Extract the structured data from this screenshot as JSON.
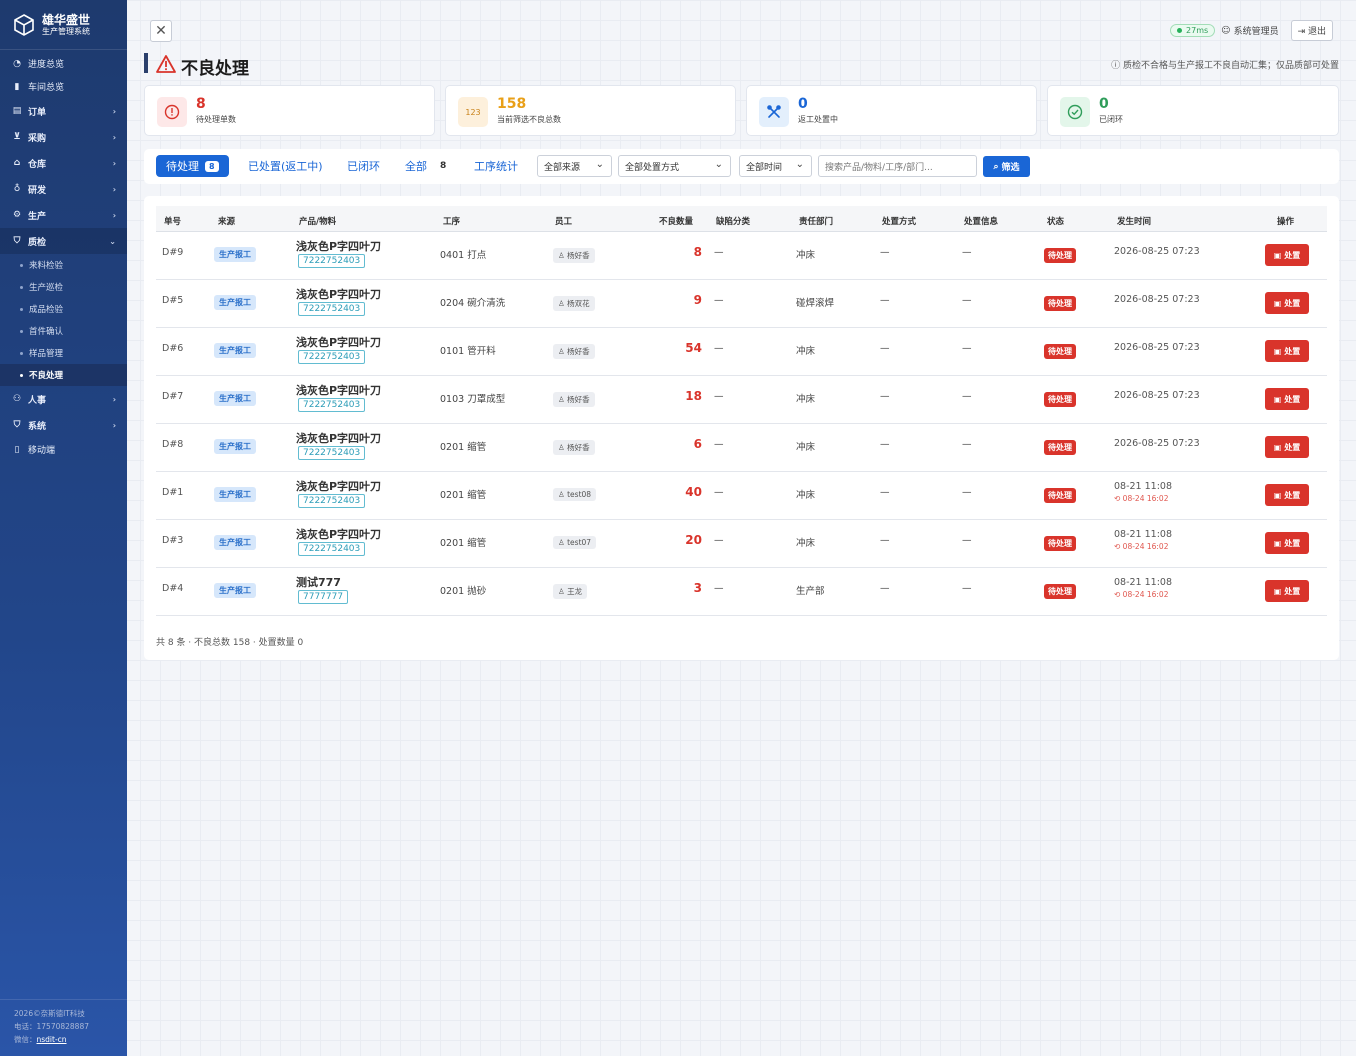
{
  "brand": {
    "title": "雄华盛世",
    "subtitle": "生产管理系统"
  },
  "sidebar": {
    "top": [
      {
        "label": "进度总览",
        "icon": "dashboard-icon"
      },
      {
        "label": "车间总览",
        "icon": "doc-icon"
      }
    ],
    "groups": [
      {
        "label": "订单",
        "icon": "order-icon"
      },
      {
        "label": "采购",
        "icon": "cart-icon"
      },
      {
        "label": "仓库",
        "icon": "home-icon"
      },
      {
        "label": "研发",
        "icon": "bulb-icon"
      },
      {
        "label": "生产",
        "icon": "gear-icon"
      }
    ],
    "open_group": {
      "label": "质检",
      "icon": "shield-icon",
      "items": [
        "来料检验",
        "生产巡检",
        "成品检验",
        "首件确认",
        "样品管理",
        "不良处理"
      ]
    },
    "bottom": [
      {
        "label": "人事",
        "icon": "people-icon"
      },
      {
        "label": "系统",
        "icon": "shield-icon"
      }
    ],
    "mobile": "移动端",
    "footer": {
      "copyright": "2026©奈斯德IT科技",
      "phone": "电话：17570828887",
      "wechat_label": "微信：",
      "wechat": "nsdit-cn"
    }
  },
  "header": {
    "latency": "27ms",
    "user": "系统管理员",
    "logout": "退出"
  },
  "page": {
    "title": "不良处理",
    "hint": "质检不合格与生产报工不良自动汇集；仅品质部可处置"
  },
  "stats": [
    {
      "value": "8",
      "label": "待处理单数",
      "color": "#d9342b",
      "bg": "#fde8e8",
      "icon": "alert-icon"
    },
    {
      "value": "158",
      "label": "当前筛选不良总数",
      "color": "#e9a018",
      "bg": "#fdf0dc",
      "icon": "123",
      "icon_name": "number-icon"
    },
    {
      "value": "0",
      "label": "返工处置中",
      "color": "#1a66d6",
      "bg": "#e3effc",
      "icon": "tools-icon"
    },
    {
      "value": "0",
      "label": "已闭环",
      "color": "#2f9d5a",
      "bg": "#e3f6ea",
      "icon": "check-icon"
    }
  ],
  "tabs": {
    "pending": "待处理",
    "pending_count": "8",
    "reworking": "已处置(返工中)",
    "closed": "已闭环",
    "all": "全部",
    "all_count": "8",
    "stats": "工序统计"
  },
  "filters": {
    "source": "全部来源",
    "method": "全部处置方式",
    "time": "全部时间",
    "search_placeholder": "搜索产品/物料/工序/部门...",
    "search_btn": "筛选"
  },
  "table": {
    "headers": [
      "单号",
      "来源",
      "产品/物料",
      "工序",
      "员工",
      "不良数量",
      "缺陷分类",
      "责任部门",
      "处置方式",
      "处置信息",
      "状态",
      "发生时间",
      "操作"
    ],
    "rows": [
      {
        "id": "D#9",
        "source": "生产报工",
        "product": "浅灰色P字四叶刀",
        "code": "7222752403",
        "process": "0401 打点",
        "employee": "杨好香",
        "qty": "8",
        "defect": "—",
        "dept": "冲床",
        "method": "—",
        "info": "—",
        "status": "待处理",
        "time": "2026-08-25 07:23",
        "time_sub": "",
        "action": "处置"
      },
      {
        "id": "D#5",
        "source": "生产报工",
        "product": "浅灰色P字四叶刀",
        "code": "7222752403",
        "process": "0204 碗介清洗",
        "employee": "杨双花",
        "qty": "9",
        "defect": "—",
        "dept": "碰焊滚焊",
        "method": "—",
        "info": "—",
        "status": "待处理",
        "time": "2026-08-25 07:23",
        "time_sub": "",
        "action": "处置"
      },
      {
        "id": "D#6",
        "source": "生产报工",
        "product": "浅灰色P字四叶刀",
        "code": "7222752403",
        "process": "0101 管开料",
        "employee": "杨好香",
        "qty": "54",
        "defect": "—",
        "dept": "冲床",
        "method": "—",
        "info": "—",
        "status": "待处理",
        "time": "2026-08-25 07:23",
        "time_sub": "",
        "action": "处置"
      },
      {
        "id": "D#7",
        "source": "生产报工",
        "product": "浅灰色P字四叶刀",
        "code": "7222752403",
        "process": "0103 刀罩成型",
        "employee": "杨好香",
        "qty": "18",
        "defect": "—",
        "dept": "冲床",
        "method": "—",
        "info": "—",
        "status": "待处理",
        "time": "2026-08-25 07:23",
        "time_sub": "",
        "action": "处置"
      },
      {
        "id": "D#8",
        "source": "生产报工",
        "product": "浅灰色P字四叶刀",
        "code": "7222752403",
        "process": "0201 缩管",
        "employee": "杨好香",
        "qty": "6",
        "defect": "—",
        "dept": "冲床",
        "method": "—",
        "info": "—",
        "status": "待处理",
        "time": "2026-08-25 07:23",
        "time_sub": "",
        "action": "处置"
      },
      {
        "id": "D#1",
        "source": "生产报工",
        "product": "浅灰色P字四叶刀",
        "code": "7222752403",
        "process": "0201 缩管",
        "employee": "test08",
        "qty": "40",
        "defect": "—",
        "dept": "冲床",
        "method": "—",
        "info": "—",
        "status": "待处理",
        "time": "08-21 11:08",
        "time_sub": "08-24 16:02",
        "action": "处置"
      },
      {
        "id": "D#3",
        "source": "生产报工",
        "product": "浅灰色P字四叶刀",
        "code": "7222752403",
        "process": "0201 缩管",
        "employee": "test07",
        "qty": "20",
        "defect": "—",
        "dept": "冲床",
        "method": "—",
        "info": "—",
        "status": "待处理",
        "time": "08-21 11:08",
        "time_sub": "08-24 16:02",
        "action": "处置"
      },
      {
        "id": "D#4",
        "source": "生产报工",
        "product": "测试777",
        "code": "7777777",
        "process": "0201 抛砂",
        "employee": "王龙",
        "qty": "3",
        "defect": "—",
        "dept": "生产部",
        "method": "—",
        "info": "—",
        "status": "待处理",
        "time": "08-21 11:08",
        "time_sub": "08-24 16:02",
        "action": "处置"
      }
    ],
    "summary": "共 8 条 · 不良总数 158 · 处置数量 0"
  }
}
